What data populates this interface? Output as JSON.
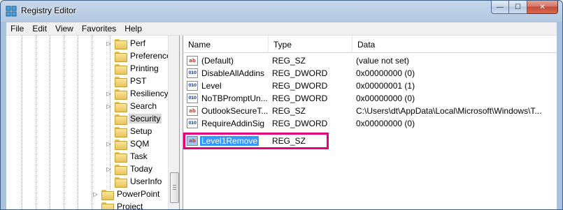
{
  "window": {
    "title": "Registry Editor",
    "caption_buttons": {
      "minimize": "—",
      "maximize": "☐",
      "close": "✕"
    }
  },
  "menubar": [
    "File",
    "Edit",
    "View",
    "Favorites",
    "Help"
  ],
  "tree": {
    "items": [
      {
        "label": "Perf",
        "expander": "▷",
        "selected": false
      },
      {
        "label": "Preferences",
        "expander": "",
        "selected": false
      },
      {
        "label": "Printing",
        "expander": "",
        "selected": false
      },
      {
        "label": "PST",
        "expander": "",
        "selected": false
      },
      {
        "label": "Resiliency",
        "expander": "▷",
        "selected": false
      },
      {
        "label": "Search",
        "expander": "▷",
        "selected": false
      },
      {
        "label": "Security",
        "expander": "",
        "selected": true
      },
      {
        "label": "Setup",
        "expander": "",
        "selected": false
      },
      {
        "label": "SQM",
        "expander": "▷",
        "selected": false
      },
      {
        "label": "Task",
        "expander": "",
        "selected": false
      },
      {
        "label": "Today",
        "expander": "▷",
        "selected": false
      },
      {
        "label": "UserInfo",
        "expander": "",
        "selected": false
      },
      {
        "label": "PowerPoint",
        "expander": "▷",
        "selected": false
      },
      {
        "label": "Project",
        "expander": "",
        "selected": false
      }
    ]
  },
  "list": {
    "columns": {
      "name": "Name",
      "type": "Type",
      "data": "Data"
    },
    "rows": [
      {
        "icon": "string-value-icon",
        "icon_text": "ab",
        "name": "(Default)",
        "type": "REG_SZ",
        "data": "(value not set)"
      },
      {
        "icon": "dword-value-icon",
        "icon_text": "010",
        "name": "DisableAllAddins",
        "type": "REG_DWORD",
        "data": "0x00000000 (0)"
      },
      {
        "icon": "dword-value-icon",
        "icon_text": "010",
        "name": "Level",
        "type": "REG_DWORD",
        "data": "0x00000001 (1)"
      },
      {
        "icon": "dword-value-icon",
        "icon_text": "010",
        "name": "NoTBPromptUn...",
        "type": "REG_DWORD",
        "data": "0x00000000 (0)"
      },
      {
        "icon": "string-value-icon",
        "icon_text": "ab",
        "name": "OutlookSecureT...",
        "type": "REG_SZ",
        "data": "C:\\Users\\dt\\AppData\\Local\\Microsoft\\Windows\\T..."
      },
      {
        "icon": "dword-value-icon",
        "icon_text": "010",
        "name": "RequireAddinSig",
        "type": "REG_DWORD",
        "data": "0x00000000 (0)"
      },
      {
        "icon": "string-value-icon",
        "icon_text": "ab",
        "name": "Level1Remove",
        "type": "REG_SZ",
        "data": "",
        "selected": true
      }
    ]
  },
  "colors": {
    "highlight_box": "#e6007e",
    "selection": "#3399ff"
  }
}
